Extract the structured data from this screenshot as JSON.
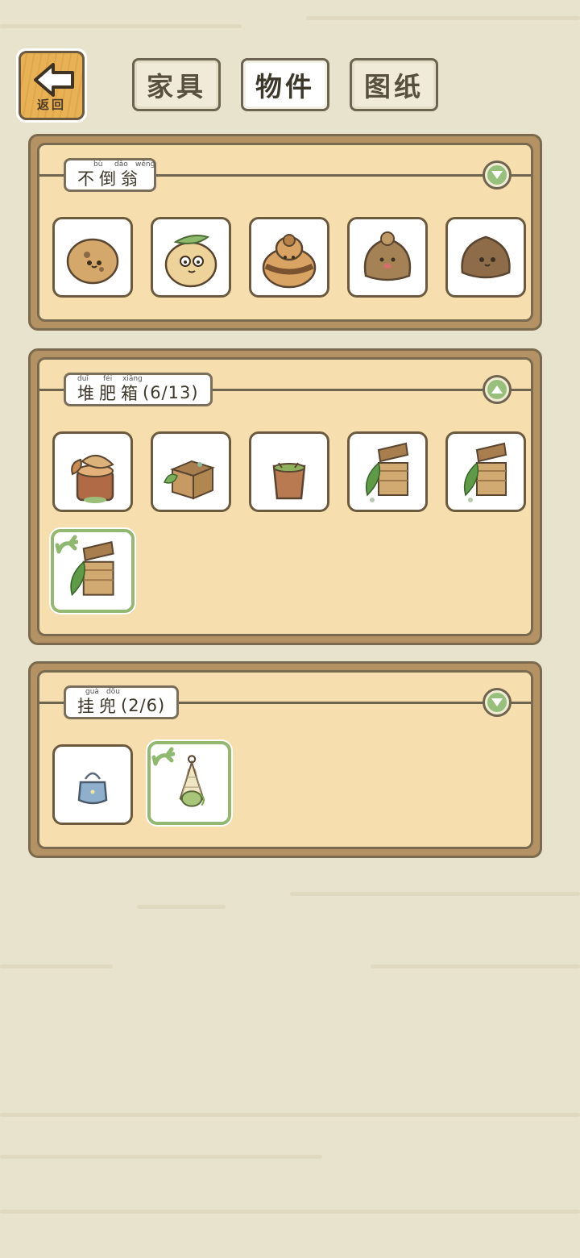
{
  "back_button": {
    "label": "返回"
  },
  "tabs": [
    {
      "label": "家具",
      "active": false
    },
    {
      "label": "物件",
      "active": true
    },
    {
      "label": "图纸",
      "active": false
    }
  ],
  "categories": [
    {
      "title": "不倒翁",
      "pinyin": [
        "bù",
        "dǎo",
        "wēng"
      ],
      "count": "",
      "toggle": "expand",
      "items": [
        "tumbler-spotted",
        "tumbler-leaf",
        "tumbler-striped",
        "tumbler-knob",
        "tumbler-dark"
      ]
    },
    {
      "title": "堆肥箱",
      "pinyin": [
        "duī",
        "féi",
        "xiāng"
      ],
      "count": "(6/13)",
      "toggle": "collapse",
      "items": [
        "compost-stump",
        "compost-crate",
        "compost-bucket",
        "compost-box",
        "compost-box",
        "compost-box-selected"
      ]
    },
    {
      "title": "挂兜",
      "pinyin": [
        "guà",
        "dōu"
      ],
      "count": "(2/6)",
      "toggle": "expand",
      "items": [
        "bag-blue",
        "bag-net-selected"
      ]
    }
  ],
  "colors": {
    "background": "#e8e3cd",
    "panel_fill": "#f6deae",
    "panel_border": "#b49263",
    "accent_green": "#98c07d"
  }
}
